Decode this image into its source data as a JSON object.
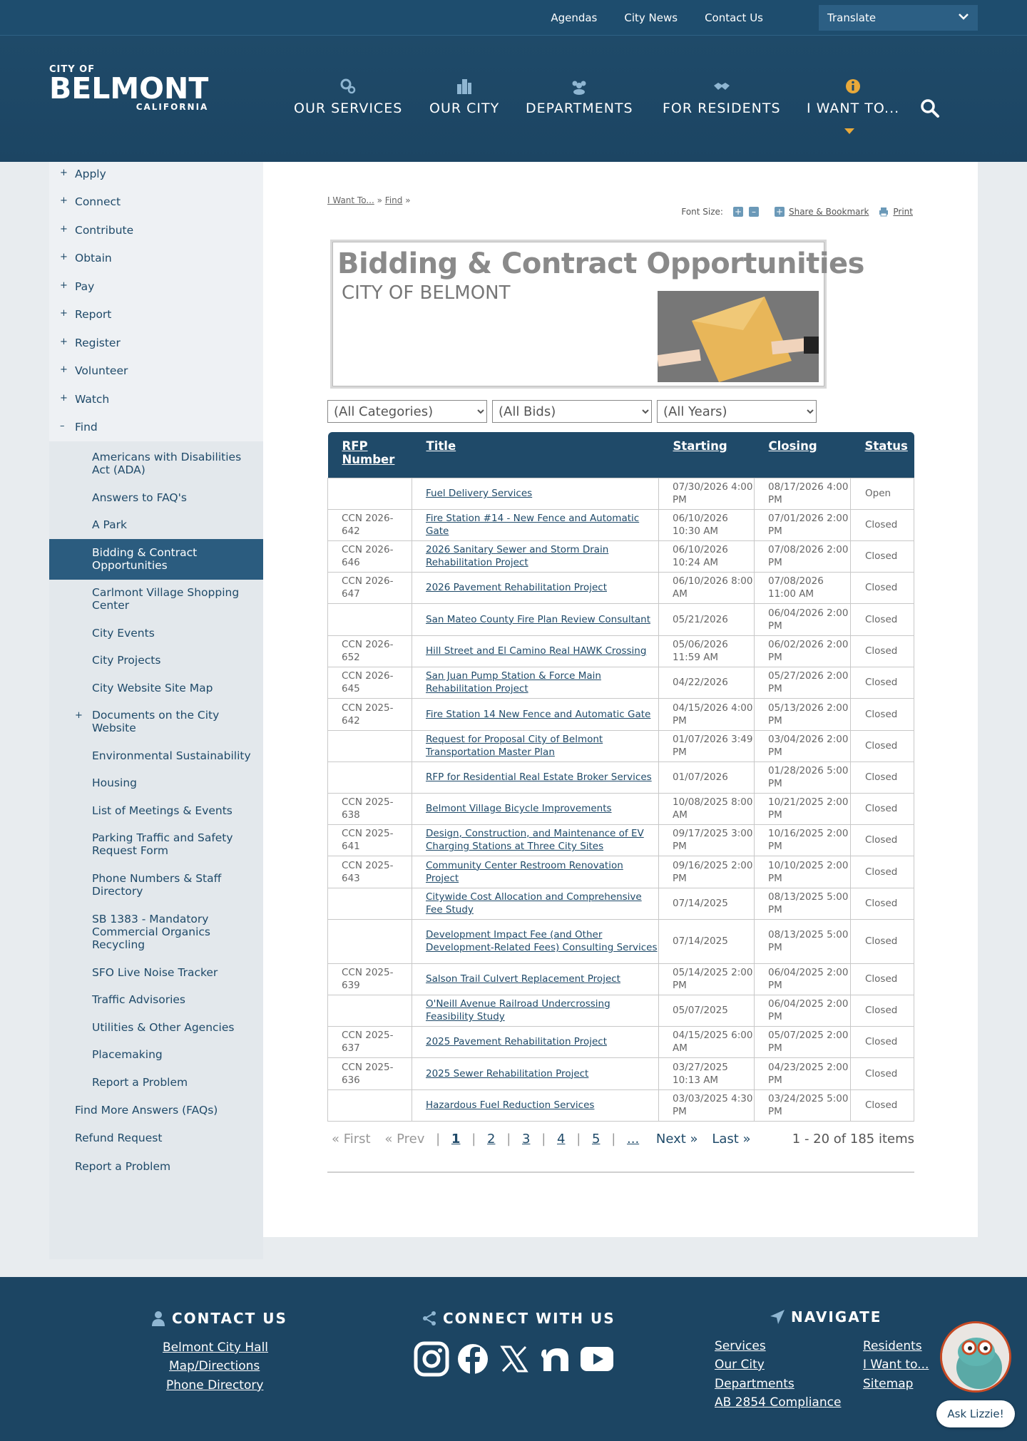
{
  "topbar": {
    "links": [
      "Agendas",
      "City News",
      "Contact Us"
    ],
    "translate_label": "Translate"
  },
  "logo": {
    "line1": "CITY OF",
    "line2": "BELMONT",
    "line3": "CALIFORNIA"
  },
  "nav": {
    "items": [
      "OUR SERVICES",
      "OUR CITY",
      "DEPARTMENTS",
      "FOR RESIDENTS",
      "I WANT TO..."
    ]
  },
  "sidebar": {
    "top_items": [
      "Apply",
      "Connect",
      "Contribute",
      "Obtain",
      "Pay",
      "Report",
      "Register",
      "Volunteer",
      "Watch"
    ],
    "find_label": "Find",
    "find_items": [
      "Americans with Disabilities Act (ADA)",
      "Answers to FAQ's",
      "A Park",
      "Bidding & Contract Opportunities",
      "Carlmont Village Shopping Center",
      "City Events",
      "City Projects",
      "City Website Site Map",
      "Documents on the City Website",
      "Environmental Sustainability",
      "Housing",
      "List of Meetings & Events",
      "Parking Traffic and Safety Request Form",
      "Phone Numbers & Staff Directory",
      "SB 1383 - Mandatory Commercial Organics Recycling",
      "SFO Live Noise Tracker",
      "Traffic Advisories",
      "Utilities & Other Agencies",
      "Placemaking",
      "Report a Problem"
    ],
    "bottom_items": [
      "Find More Answers (FAQs)",
      "Refund Request",
      "Report a Problem"
    ]
  },
  "breadcrumb": {
    "a": "I Want To...",
    "b": "Find",
    "sep": "»"
  },
  "tools": {
    "font_size": "Font Size:",
    "share": "Share & Bookmark",
    "print": "Print"
  },
  "banner": {
    "title": "Bidding & Contract Opportunities",
    "subtitle": "CITY OF BELMONT"
  },
  "filters": {
    "categories": "(All Categories)",
    "bids": "(All Bids)",
    "years": "(All Years)"
  },
  "table": {
    "headers": [
      "RFP Number",
      "Title",
      "Starting",
      "Closing",
      "Status"
    ],
    "rows": [
      [
        "",
        "Fuel Delivery Services",
        "07/30/2026 4:00 PM",
        "08/17/2026 4:00 PM",
        "Open"
      ],
      [
        "CCN 2026-642",
        "Fire Station #14 - New Fence and Automatic Gate",
        "06/10/2026 10:30 AM",
        "07/01/2026 2:00 PM",
        "Closed"
      ],
      [
        "CCN 2026-646",
        "2026 Sanitary Sewer and Storm Drain Rehabilitation Project",
        "06/10/2026 10:24 AM",
        "07/08/2026 2:00 PM",
        "Closed"
      ],
      [
        "CCN 2026-647",
        "2026 Pavement Rehabilitation Project",
        "06/10/2026 8:00 AM",
        "07/08/2026 11:00 AM",
        "Closed"
      ],
      [
        "",
        "San Mateo County Fire Plan Review Consultant",
        "05/21/2026",
        "06/04/2026 2:00 PM",
        "Closed"
      ],
      [
        "CCN 2026-652",
        "Hill Street and El Camino Real HAWK Crossing",
        "05/06/2026 11:59 AM",
        "06/02/2026 2:00 PM",
        "Closed"
      ],
      [
        "CCN 2026-645",
        "San Juan Pump Station & Force Main Rehabilitation Project",
        "04/22/2026",
        "05/27/2026 2:00 PM",
        "Closed"
      ],
      [
        "CCN 2025-642",
        "Fire Station 14 New Fence and Automatic Gate",
        "04/15/2026 4:00 PM",
        "05/13/2026 2:00 PM",
        "Closed"
      ],
      [
        "",
        "Request for Proposal City of Belmont Transportation Master Plan",
        "01/07/2026 3:49 PM",
        "03/04/2026 2:00 PM",
        "Closed"
      ],
      [
        "",
        "RFP for Residential Real Estate Broker Services",
        "01/07/2026",
        "01/28/2026 5:00 PM",
        "Closed"
      ],
      [
        "CCN 2025-638",
        "Belmont Village Bicycle Improvements",
        "10/08/2025 8:00 AM",
        "10/21/2025 2:00 PM",
        "Closed"
      ],
      [
        "CCN 2025-641",
        "Design, Construction, and Maintenance of EV Charging Stations at Three City Sites",
        "09/17/2025 3:00 PM",
        "10/16/2025 2:00 PM",
        "Closed"
      ],
      [
        "CCN 2025-643",
        "Community Center Restroom Renovation Project",
        "09/16/2025 2:00 PM",
        "10/10/2025 2:00 PM",
        "Closed"
      ],
      [
        "",
        "Citywide Cost Allocation and Comprehensive Fee Study",
        "07/14/2025",
        "08/13/2025 5:00 PM",
        "Closed"
      ],
      [
        "",
        "Development Impact Fee (and Other Development-Related Fees) Consulting Services",
        "07/14/2025",
        "08/13/2025 5:00 PM",
        "Closed"
      ],
      [
        "CCN 2025-639",
        "Salson Trail Culvert Replacement Project",
        "05/14/2025 2:00 PM",
        "06/04/2025 2:00 PM",
        "Closed"
      ],
      [
        "",
        "O'Neill Avenue Railroad Undercrossing Feasibility Study",
        "05/07/2025",
        "06/04/2025 2:00 PM",
        "Closed"
      ],
      [
        "CCN 2025-637",
        "2025 Pavement Rehabilitation Project",
        "04/15/2025 6:00 AM",
        "05/07/2025 2:00 PM",
        "Closed"
      ],
      [
        "CCN 2025-636",
        "2025 Sewer Rehabilitation Project",
        "03/27/2025 10:13 AM",
        "04/23/2025 2:00 PM",
        "Closed"
      ],
      [
        "",
        "Hazardous Fuel Reduction Services",
        "03/03/2025 4:30 PM",
        "03/24/2025 5:00 PM",
        "Closed"
      ]
    ]
  },
  "pager": {
    "first": "« First",
    "prev": "« Prev",
    "pages": [
      "1",
      "2",
      "3",
      "4",
      "5",
      "..."
    ],
    "next": "Next »",
    "last": "Last »",
    "sep": "|",
    "count": "1 - 20 of 185 items"
  },
  "footer": {
    "contact_title": "CONTACT US",
    "contact_links": [
      "Belmont City Hall",
      "Map/Directions",
      "Phone Directory"
    ],
    "connect_title": "CONNECT WITH US",
    "navigate_title": "NAVIGATE",
    "nav_col1": [
      "Services",
      "Our City",
      "Departments",
      "AB 2854 Compliance"
    ],
    "nav_col2": [
      "Residents",
      "I Want to...",
      "Sitemap"
    ],
    "ask": "Ask Lizzie!"
  },
  "colors": {
    "primary": "#1f4a69",
    "accent": "#e8a93a",
    "active": "#2b5c7f"
  }
}
